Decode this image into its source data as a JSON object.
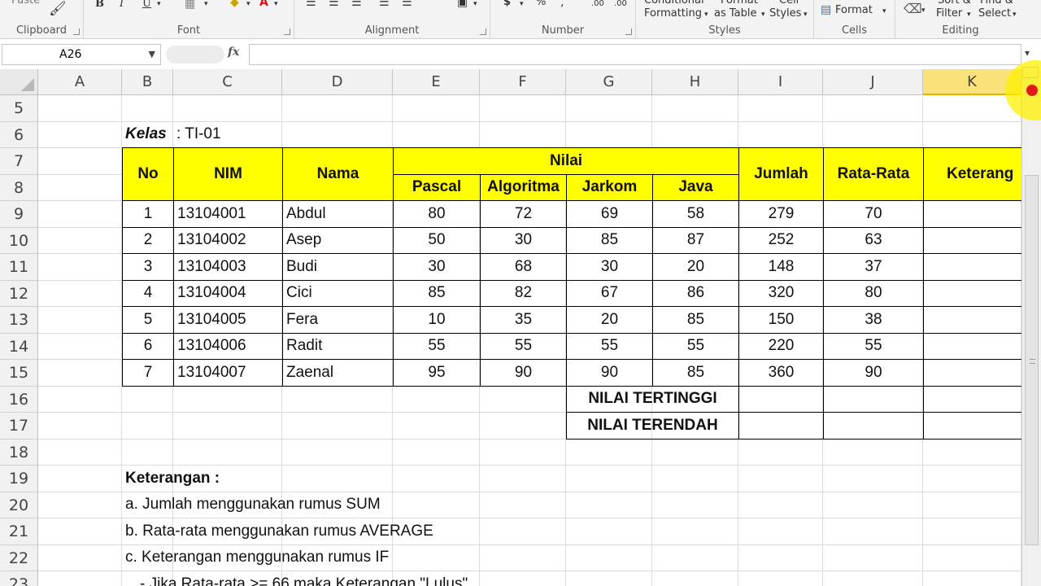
{
  "ribbon": {
    "groups": [
      {
        "label": "Clipboard"
      },
      {
        "label": "Font"
      },
      {
        "label": "Alignment"
      },
      {
        "label": "Number"
      },
      {
        "label": "Styles"
      },
      {
        "label": "Cells"
      },
      {
        "label": "Editing"
      }
    ],
    "paste_label": "Paste",
    "bold_label": "B",
    "italic_label": "I",
    "underline_label": "U",
    "currency_label": "$",
    "percent_label": "%",
    "conditional_formatting_line1": "Conditional",
    "conditional_formatting_line2": "Formatting",
    "format_as_table_line1": "Format",
    "format_as_table_line2": "as Table",
    "cell_styles_line1": "Cell",
    "cell_styles_line2": "Styles",
    "format_label": "Format",
    "sort_filter_line1": "Sort &",
    "sort_filter_line2": "Filter",
    "find_select_line1": "Find &",
    "find_select_line2": "Select"
  },
  "formula_bar": {
    "name_box": "A26",
    "fx_label": "fx",
    "formula": ""
  },
  "columns": [
    "A",
    "B",
    "C",
    "D",
    "E",
    "F",
    "G",
    "H",
    "I",
    "J",
    "K"
  ],
  "selected_column": "K",
  "rows": [
    "5",
    "6",
    "7",
    "8",
    "9",
    "10",
    "11",
    "12",
    "13",
    "14",
    "15",
    "16",
    "17",
    "18",
    "19",
    "20",
    "21",
    "22",
    "23"
  ],
  "sheet": {
    "kelas_label": "Kelas",
    "kelas_value": ": TI-01",
    "headers": {
      "no": "No",
      "nim": "NIM",
      "nama": "Nama",
      "nilai": "Nilai",
      "pascal": "Pascal",
      "algoritma": "Algoritma",
      "jarkom": "Jarkom",
      "java": "Java",
      "jumlah": "Jumlah",
      "rata_rata": "Rata-Rata",
      "keterangan": "Keterang"
    },
    "students": [
      {
        "no": "1",
        "nim": "13104001",
        "nama": "Abdul",
        "pascal": "80",
        "algoritma": "72",
        "jarkom": "69",
        "java": "58",
        "jumlah": "279",
        "rata": "70"
      },
      {
        "no": "2",
        "nim": "13104002",
        "nama": "Asep",
        "pascal": "50",
        "algoritma": "30",
        "jarkom": "85",
        "java": "87",
        "jumlah": "252",
        "rata": "63"
      },
      {
        "no": "3",
        "nim": "13104003",
        "nama": "Budi",
        "pascal": "30",
        "algoritma": "68",
        "jarkom": "30",
        "java": "20",
        "jumlah": "148",
        "rata": "37"
      },
      {
        "no": "4",
        "nim": "13104004",
        "nama": "Cici",
        "pascal": "85",
        "algoritma": "82",
        "jarkom": "67",
        "java": "86",
        "jumlah": "320",
        "rata": "80"
      },
      {
        "no": "5",
        "nim": "13104005",
        "nama": "Fera",
        "pascal": "10",
        "algoritma": "35",
        "jarkom": "20",
        "java": "85",
        "jumlah": "150",
        "rata": "38"
      },
      {
        "no": "6",
        "nim": "13104006",
        "nama": "Radit",
        "pascal": "55",
        "algoritma": "55",
        "jarkom": "55",
        "java": "55",
        "jumlah": "220",
        "rata": "55"
      },
      {
        "no": "7",
        "nim": "13104007",
        "nama": "Zaenal",
        "pascal": "95",
        "algoritma": "90",
        "jarkom": "90",
        "java": "85",
        "jumlah": "360",
        "rata": "90"
      }
    ],
    "nilai_tertinggi": "NILAI TERTINGGI",
    "nilai_terendah": "NILAI TERENDAH",
    "keterangan_title": "Keterangan :",
    "notes": [
      "a. Jumlah menggunakan rumus SUM",
      "b. Rata-rata menggunakan rumus AVERAGE",
      "c. Keterangan menggunakan rumus IF",
      "- Jika Rata-rata >= 66 maka Keterangan \"Lulus\""
    ]
  },
  "colors": {
    "header_fill": "#ffff00",
    "selected_column_header": "#f9e27a",
    "cursor_highlight": "#fff000"
  }
}
